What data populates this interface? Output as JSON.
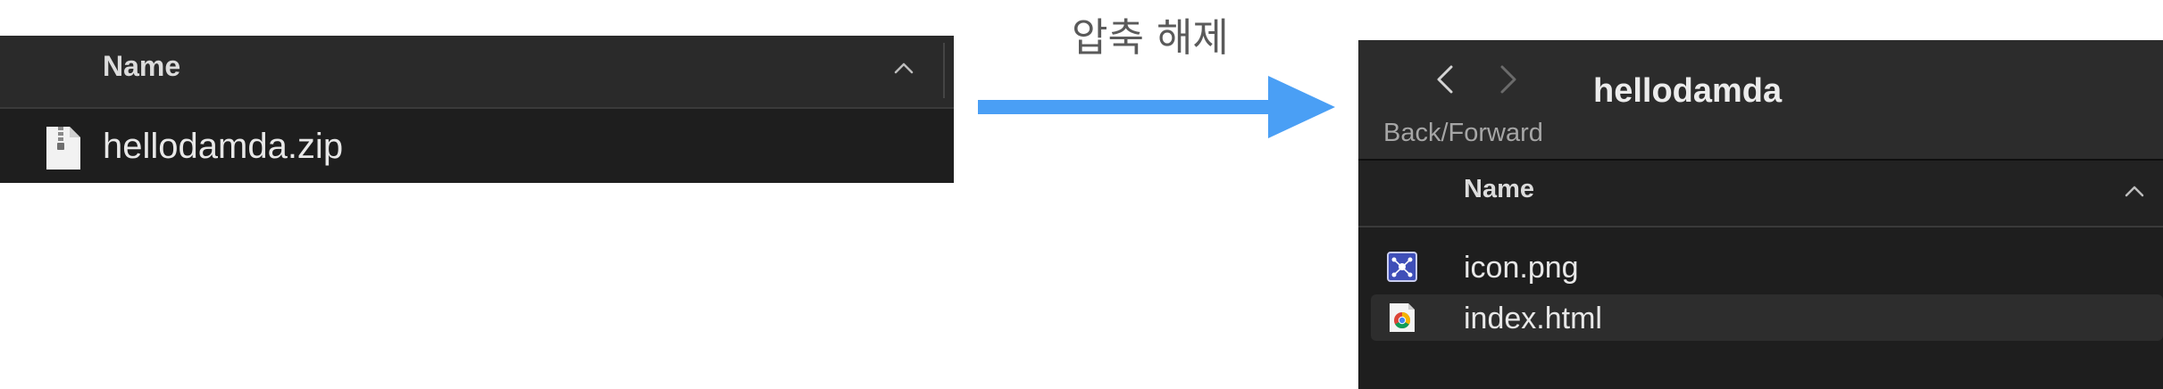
{
  "left_window": {
    "column_header": "Name",
    "sort_icon": "chevron-up-icon",
    "file": {
      "name": "hellodamda.zip",
      "icon": "zip-file-icon"
    }
  },
  "transition": {
    "caption": "압축 해제",
    "arrow_color": "#4a9ff5",
    "icon": "right-arrow-icon"
  },
  "right_window": {
    "toolbar": {
      "back_icon": "chevron-left-icon",
      "forward_icon": "chevron-right-icon",
      "nav_label": "Back/Forward",
      "title": "hellodamda"
    },
    "column_header": "Name",
    "sort_icon": "chevron-up-icon",
    "files": [
      {
        "name": "icon.png",
        "icon": "png-image-icon",
        "selected": false
      },
      {
        "name": "index.html",
        "icon": "chrome-html-icon",
        "selected": true
      }
    ]
  },
  "colors": {
    "panel_bg": "#1e1e1e",
    "accent_arrow": "#4a9ff5",
    "text_light": "#e8e8e8"
  }
}
